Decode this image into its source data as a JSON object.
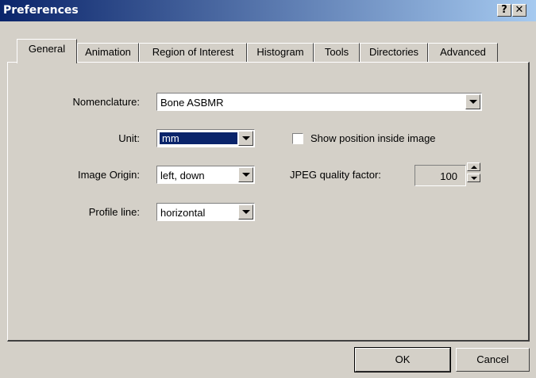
{
  "window": {
    "title": "Preferences",
    "help_label": "?",
    "close_label": "✕"
  },
  "tabs": [
    {
      "label": "General"
    },
    {
      "label": "Animation"
    },
    {
      "label": "Region of Interest"
    },
    {
      "label": "Histogram"
    },
    {
      "label": "Tools"
    },
    {
      "label": "Directories"
    },
    {
      "label": "Advanced"
    }
  ],
  "form": {
    "nomenclature": {
      "label": "Nomenclature:",
      "value": "Bone ASBMR"
    },
    "unit": {
      "label": "Unit:",
      "value": "mm"
    },
    "image_origin": {
      "label": "Image Origin:",
      "value": "left, down"
    },
    "profile_line": {
      "label": "Profile line:",
      "value": "horizontal"
    },
    "show_position": {
      "label": "Show position inside image",
      "checked": false
    },
    "jpeg_quality": {
      "label": "JPEG quality factor:",
      "value": "100"
    }
  },
  "buttons": {
    "ok": "OK",
    "cancel": "Cancel"
  },
  "colors": {
    "face": "#d4d0c8",
    "title_start": "#0a246a",
    "title_end": "#a6caf0",
    "selection": "#0a246a"
  }
}
